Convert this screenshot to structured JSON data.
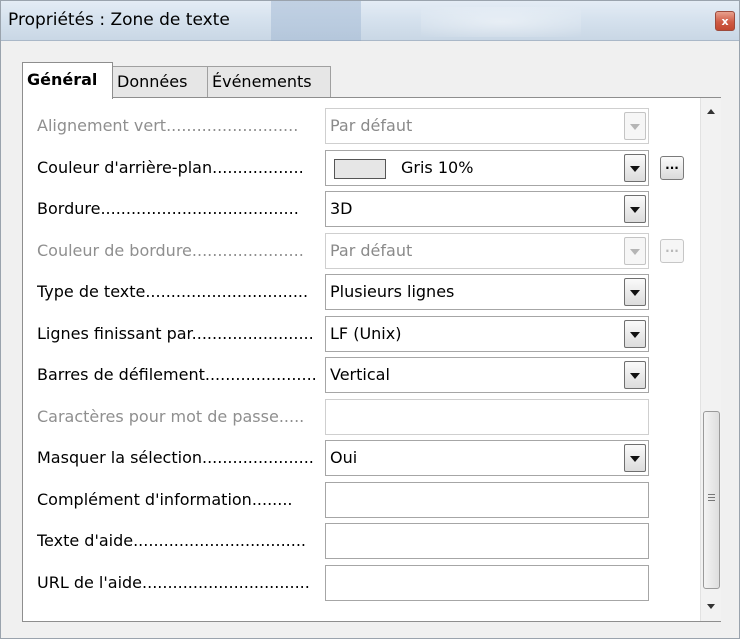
{
  "window": {
    "title": "Propriétés : Zone de texte",
    "close_label": "x"
  },
  "tabs": [
    {
      "label": "Général",
      "active": true
    },
    {
      "label": "Données",
      "active": false
    },
    {
      "label": "Événements",
      "active": false
    }
  ],
  "rows": [
    {
      "label": "Alignement vert",
      "dots": "..........................",
      "value": "Par défaut",
      "control": "dropdown",
      "disabled": true,
      "more_button": false
    },
    {
      "label": "Couleur d'arrière-plan",
      "dots": "..................",
      "value": "Gris 10%",
      "control": "color-dropdown",
      "swatch_color": "#e6e6e6",
      "disabled": false,
      "more_button": true,
      "more_label": "..."
    },
    {
      "label": "Bordure",
      "dots": ".......................................",
      "value": "3D",
      "control": "dropdown",
      "disabled": false,
      "more_button": false
    },
    {
      "label": "Couleur de bordure",
      "dots": "......................",
      "value": "Par défaut",
      "control": "dropdown",
      "disabled": true,
      "more_button": true,
      "more_label": "..."
    },
    {
      "label": "Type de texte",
      "dots": "................................",
      "value": "Plusieurs lignes",
      "control": "dropdown",
      "disabled": false,
      "more_button": false
    },
    {
      "label": "Lignes finissant par",
      "dots": "........................",
      "value": "LF (Unix)",
      "control": "dropdown",
      "disabled": false,
      "more_button": false
    },
    {
      "label": "Barres de défilement",
      "dots": "......................",
      "value": "Vertical",
      "control": "dropdown",
      "disabled": false,
      "more_button": false
    },
    {
      "label": "Caractères pour mot de passe",
      "dots": ".....",
      "value": "",
      "control": "text",
      "disabled": true,
      "more_button": false
    },
    {
      "label": "Masquer la sélection",
      "dots": "......................",
      "value": "Oui",
      "control": "dropdown",
      "disabled": false,
      "more_button": false
    },
    {
      "label": "Complément d'information",
      "dots": "........",
      "value": "",
      "control": "text",
      "disabled": false,
      "more_button": false
    },
    {
      "label": "Texte d'aide",
      "dots": "..................................",
      "value": "",
      "control": "text",
      "disabled": false,
      "more_button": false
    },
    {
      "label": "URL de l'aide",
      "dots": ".................................",
      "value": "",
      "control": "text",
      "disabled": false,
      "more_button": false
    }
  ],
  "colors": {
    "title_bar": "#d6e2ee",
    "close_button": "#cf5b45",
    "disabled_text": "#8f8f8f",
    "panel_background": "#ffffff"
  },
  "icons": {
    "close": "close-icon",
    "dropdown": "chevron-down-icon",
    "scroll_up": "arrow-up-icon",
    "scroll_down": "arrow-down-icon",
    "more": "ellipsis-icon"
  }
}
